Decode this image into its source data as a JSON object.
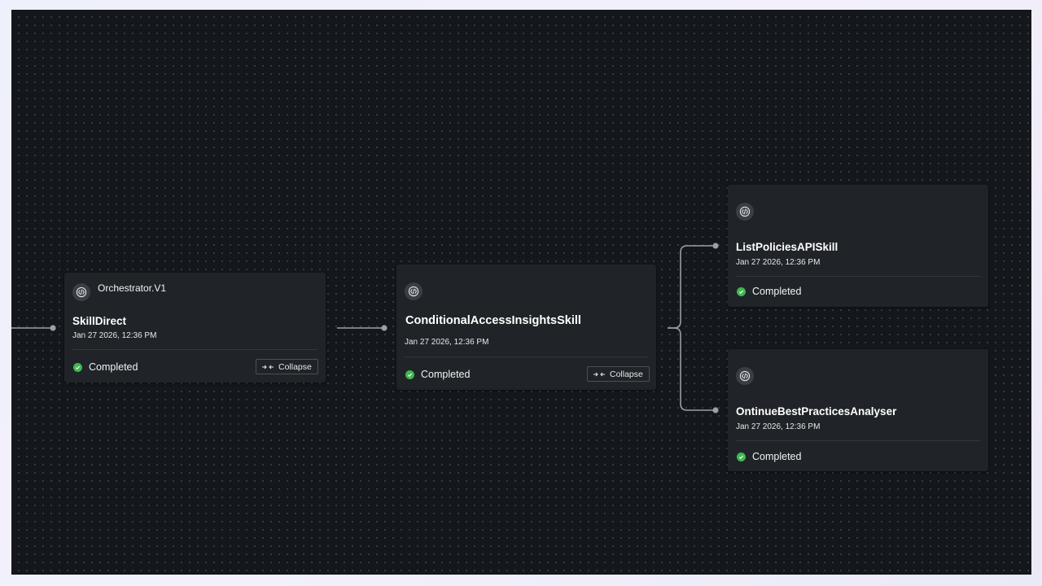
{
  "nodes": {
    "orchestrator": {
      "label": "Orchestrator.V1",
      "title": "SkillDirect",
      "timestamp": "Jan 27 2026, 12:36 PM",
      "status": "Completed",
      "collapse_label": "Collapse",
      "icon": "code-brackets-icon"
    },
    "conditional": {
      "title": "ConditionalAccessInsightsSkill",
      "timestamp": "Jan 27 2026, 12:36 PM",
      "status": "Completed",
      "collapse_label": "Collapse",
      "icon": "code-brackets-icon"
    },
    "list_policies": {
      "title": "ListPoliciesAPISkill",
      "timestamp": "Jan 27 2026, 12:36 PM",
      "status": "Completed",
      "icon": "code-brackets-icon"
    },
    "best_practices": {
      "title": "OntinueBestPracticesAnalyser",
      "timestamp": "Jan 27 2026, 12:36 PM",
      "status": "Completed",
      "icon": "code-brackets-icon"
    }
  },
  "colors": {
    "canvas_bg": "#14171b",
    "node_bg": "#202428",
    "status_success": "#3fb950",
    "edge": "#9aa0a6"
  }
}
